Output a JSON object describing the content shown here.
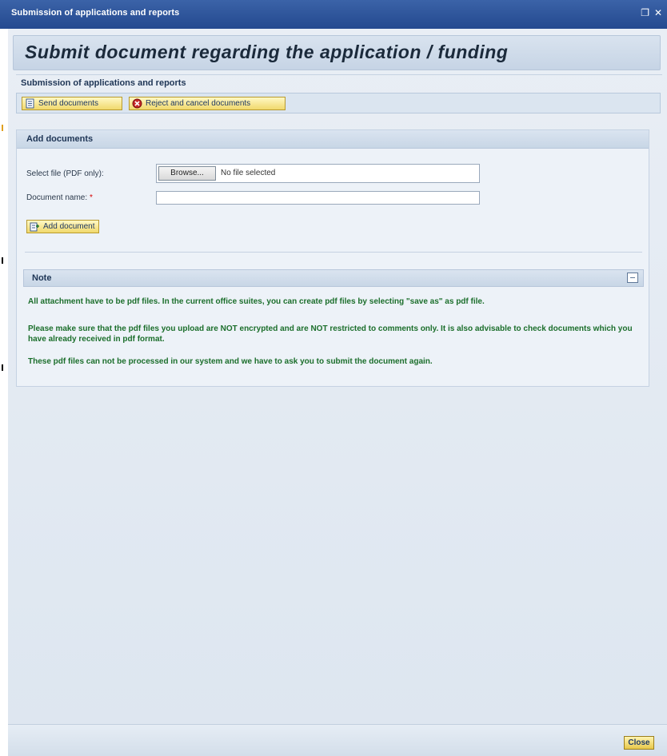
{
  "window": {
    "title": "Submission of applications and reports",
    "controls": {
      "restore_icon": "restore-icon",
      "close_icon": "close-icon",
      "restore_glyph": "❐",
      "close_glyph": "✕"
    }
  },
  "header": {
    "title": "Submit document regarding the application / funding"
  },
  "section": {
    "subtitle": "Submission of applications and reports"
  },
  "toolbar": {
    "send_label": "Send documents",
    "reject_label": "Reject and cancel documents"
  },
  "add_panel": {
    "title": "Add documents",
    "select_file_label": "Select file (PDF only):",
    "browse_label": "Browse...",
    "no_file_text": "No file selected",
    "document_name_label": "Document name:",
    "required_marker": "*",
    "document_name_value": "",
    "add_button_label": "Add document"
  },
  "note": {
    "title": "Note",
    "lines": [
      "All attachment have to be pdf files. In the current office suites, you can create pdf files by selecting \"save as\" as pdf file.",
      "Please make sure that the pdf files you upload are NOT encrypted and are NOT restricted to comments only. It is also advisable to check documents which you have already received in pdf format.",
      "These pdf files can not be processed in our system and we have to ask you to submit the document again."
    ]
  },
  "footer": {
    "close_label": "Close"
  },
  "colors": {
    "titlebar": "#2a4f93",
    "note_text": "#1b6e2b",
    "button_yellow": "#f1d96c",
    "required": "#d60000"
  }
}
